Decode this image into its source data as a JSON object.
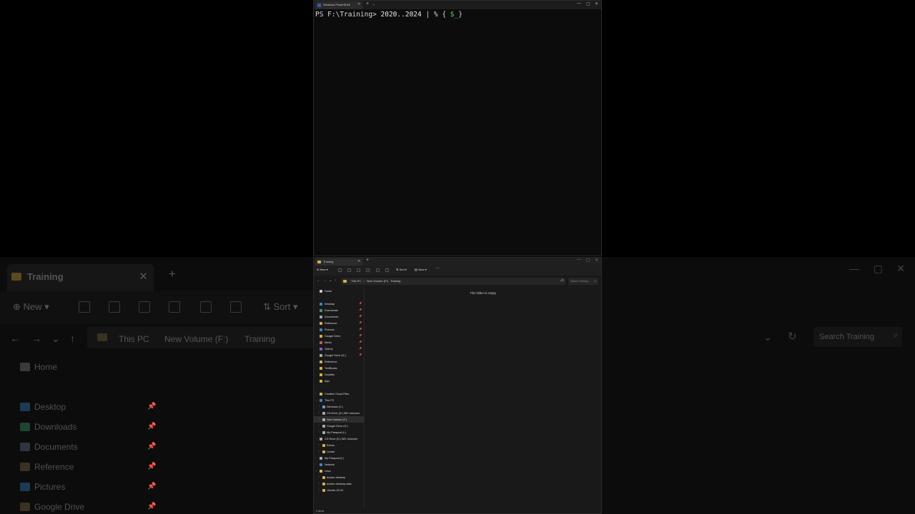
{
  "terminal": {
    "tab_title": "Windows PowerShell",
    "prompt": "PS F:\\Training> ",
    "arg_start": "2020",
    "range_op": "..",
    "arg_end": "2024",
    "pipe": " | % { ",
    "var": "$_",
    "close": "}"
  },
  "explorer": {
    "tab_title": "Training",
    "toolbar": {
      "new_label": "New",
      "sort_label": "Sort",
      "view_label": "View",
      "more_label": "···"
    },
    "address": {
      "crumb_1": "This PC",
      "crumb_2": "New Volume (F:)",
      "crumb_3": "Training"
    },
    "search_placeholder": "Search Training",
    "empty_message": "This folder is empty.",
    "status": "0 items",
    "nav": [
      {
        "label": "Home",
        "color": "#c9c9c9"
      },
      {
        "label": "Desktop",
        "color": "#3a86d1"
      },
      {
        "label": "Downloads",
        "color": "#3ea36a"
      },
      {
        "label": "Documents",
        "color": "#9aa6b8"
      },
      {
        "label": "Reference",
        "color": "#d9b14a"
      },
      {
        "label": "Pictures",
        "color": "#3a86d1"
      },
      {
        "label": "Google Drive",
        "color": "#d9b14a"
      },
      {
        "label": "Music",
        "color": "#d35a3e"
      },
      {
        "label": "Videos",
        "color": "#8c5bd1"
      },
      {
        "label": "Google Drive (G:)",
        "color": "#aaaaaa"
      },
      {
        "label": "Reference",
        "color": "#d9b14a"
      },
      {
        "label": "TextBooks",
        "color": "#d9b14a"
      },
      {
        "label": "Doodles",
        "color": "#d9b14a"
      },
      {
        "label": "dipo",
        "color": "#d9b14a"
      },
      {
        "label": "Creative Cloud Files",
        "color": "#d9b14a"
      },
      {
        "label": "This PC",
        "color": "#3a86d1"
      },
      {
        "label": "Windows (C:)",
        "color": "#6c9bd2"
      },
      {
        "label": "CD Drive (D:) WD Unlocker",
        "color": "#aaaaaa"
      },
      {
        "label": "New Volume (F:)",
        "color": "#aaaaaa"
      },
      {
        "label": "Google Drive (G:)",
        "color": "#aaaaaa"
      },
      {
        "label": "My Passport (I:)",
        "color": "#aaaaaa"
      },
      {
        "label": "CD Drive (D:) WD Unlocker",
        "color": "#aaaaaa"
      },
      {
        "label": "Extras",
        "color": "#d9b14a"
      },
      {
        "label": "Locale",
        "color": "#d9b14a"
      },
      {
        "label": "My Passport (I:)",
        "color": "#aaaaaa"
      },
      {
        "label": "Network",
        "color": "#3a86d1"
      },
      {
        "label": "Linux",
        "color": "#e0c040"
      },
      {
        "label": "docker-desktop",
        "color": "#d9b14a"
      },
      {
        "label": "docker-desktop-data",
        "color": "#d9b14a"
      },
      {
        "label": "Ubuntu-20.04",
        "color": "#d9b14a"
      }
    ]
  },
  "background": {
    "tab_title": "Training",
    "new_label": "New",
    "sort_label": "Sort",
    "crumb_1": "This PC",
    "crumb_2": "New Volume (F:)",
    "crumb_3": "Training",
    "search_placeholder": "Search Training",
    "nav": [
      "Home",
      "Desktop",
      "Downloads",
      "Documents",
      "Reference",
      "Pictures",
      "Google Drive"
    ]
  }
}
